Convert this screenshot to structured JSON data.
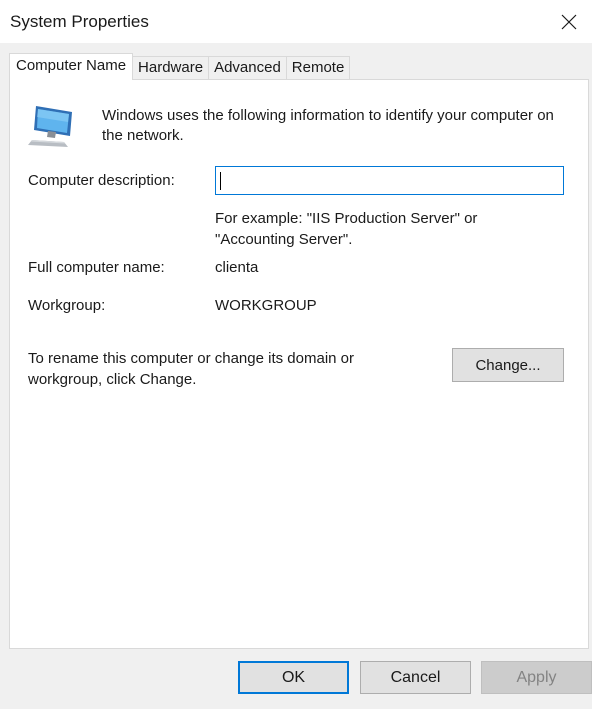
{
  "window": {
    "title": "System Properties"
  },
  "tabs": [
    {
      "label": "Computer Name",
      "active": true
    },
    {
      "label": "Hardware",
      "active": false
    },
    {
      "label": "Advanced",
      "active": false
    },
    {
      "label": "Remote",
      "active": false
    }
  ],
  "panel": {
    "intro": "Windows uses the following information to identify your computer on the network.",
    "description_label": "Computer description:",
    "description_value": "",
    "example_text": "For example: \"IIS Production Server\" or \"Accounting Server\".",
    "full_name_label": "Full computer name:",
    "full_name_value": "clienta",
    "workgroup_label": "Workgroup:",
    "workgroup_value": "WORKGROUP",
    "rename_text": "To rename this computer or change its domain or workgroup, click Change.",
    "change_label": "Change..."
  },
  "footer": {
    "ok_label": "OK",
    "cancel_label": "Cancel",
    "apply_label": "Apply"
  },
  "colors": {
    "accent": "#0078d7",
    "dialog_bg": "#f0f0f0",
    "button_bg": "#e1e1e1"
  },
  "icons": {
    "computer": "computer-monitor-icon",
    "close": "close-icon"
  }
}
